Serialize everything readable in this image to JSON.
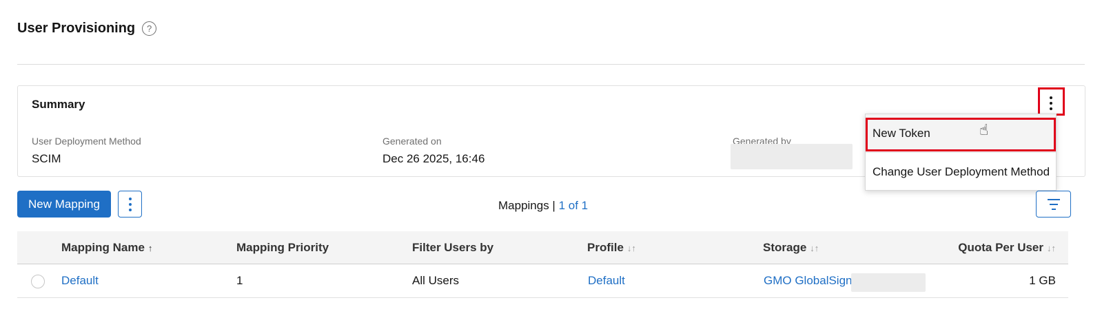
{
  "page": {
    "title": "User Provisioning",
    "help_icon": "?"
  },
  "summary": {
    "title": "Summary",
    "fields": [
      {
        "label": "User Deployment Method",
        "value": "SCIM"
      },
      {
        "label": "Generated on",
        "value": "Dec 26 2025, 16:46"
      },
      {
        "label": "Generated by",
        "value": ""
      }
    ],
    "menu": {
      "items": [
        "New Token",
        "Change User Deployment Method"
      ]
    }
  },
  "toolbar": {
    "new_mapping_label": "New Mapping",
    "mappings_label": "Mappings |",
    "mappings_count": "1 of 1"
  },
  "table": {
    "columns": [
      {
        "label": "Mapping Name",
        "sort": "↑"
      },
      {
        "label": "Mapping Priority",
        "sort": ""
      },
      {
        "label": "Filter Users by",
        "sort": ""
      },
      {
        "label": "Profile",
        "sort": "↓↑"
      },
      {
        "label": "Storage",
        "sort": "↓↑"
      },
      {
        "label": "Quota Per User",
        "sort": "↓↑"
      }
    ],
    "rows": [
      {
        "mapping_name": "Default",
        "mapping_priority": "1",
        "filter_users_by": "All Users",
        "profile": "Default",
        "storage": "GMO GlobalSign",
        "quota_per_user": "1 GB"
      }
    ]
  },
  "colors": {
    "accent": "#1f6fc5",
    "highlight": "#e0001a"
  }
}
